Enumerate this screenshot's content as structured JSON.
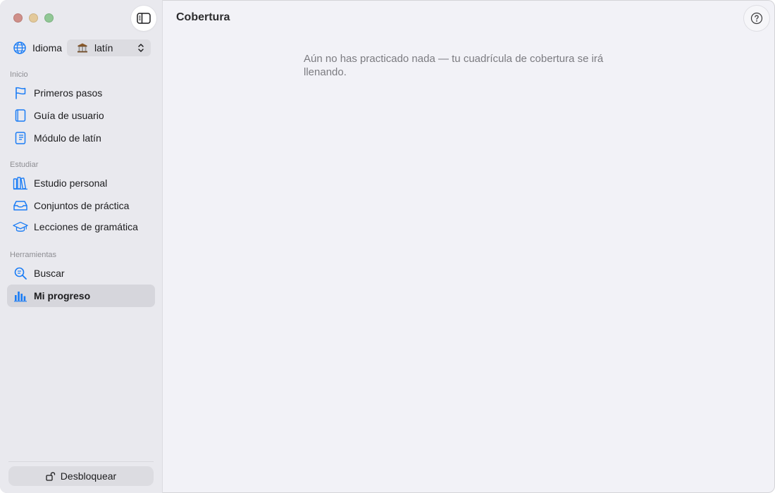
{
  "window": {
    "title": "Cobertura"
  },
  "sidebar": {
    "language": {
      "label": "Idioma",
      "selected": "latín",
      "icon": "columns-temple-icon"
    },
    "sections": [
      {
        "title": "Inicio",
        "items": [
          {
            "label": "Primeros pasos",
            "icon": "flag-icon"
          },
          {
            "label": "Guía de usuario",
            "icon": "book-icon"
          },
          {
            "label": "Módulo de latín",
            "icon": "book-text-icon"
          }
        ]
      },
      {
        "title": "Estudiar",
        "items": [
          {
            "label": "Estudio personal",
            "icon": "books-shelf-icon"
          },
          {
            "label": "Conjuntos de práctica",
            "icon": "tray-icon"
          },
          {
            "label": "Lecciones de gramática",
            "icon": "graduation-cap-icon"
          }
        ]
      },
      {
        "title": "Herramientas",
        "items": [
          {
            "label": "Buscar",
            "icon": "search-icon"
          },
          {
            "label": "Mi progreso",
            "icon": "bar-chart-icon",
            "selected": true
          }
        ]
      }
    ],
    "unlock_label": "Desbloquear"
  },
  "main": {
    "empty_message": "Aún no has practicado nada — tu cuadrícula de cobertura se irá llenando."
  },
  "colors": {
    "accent": "#1a7cf5",
    "sidebar_bg": "#e9e9ee",
    "content_bg": "#f2f2f7"
  }
}
